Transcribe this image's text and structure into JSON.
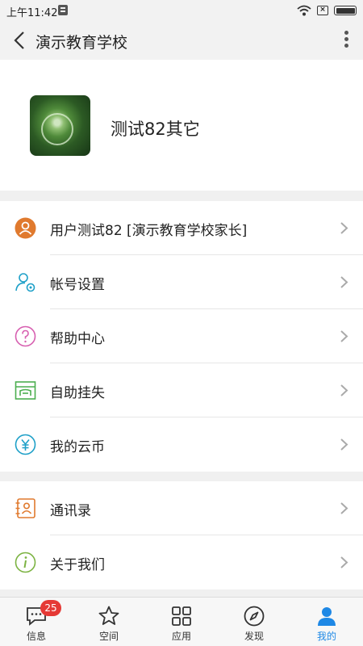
{
  "statusbar": {
    "time": "上午11:42"
  },
  "navbar": {
    "title": "演示教育学校"
  },
  "profile": {
    "name": "测试82其它"
  },
  "menu_group_1": [
    {
      "label": "用户测试82 [演示教育学校家长]",
      "icon": "user-icon",
      "color": "#e07a2e"
    },
    {
      "label": "帐号设置",
      "icon": "account-settings-icon",
      "color": "#1ea0c8"
    },
    {
      "label": "帮助中心",
      "icon": "help-icon",
      "color": "#d75fb0"
    },
    {
      "label": "自助挂失",
      "icon": "report-loss-icon",
      "color": "#4caf50"
    },
    {
      "label": "我的云币",
      "icon": "coin-icon",
      "color": "#1ea0c8"
    }
  ],
  "menu_group_2": [
    {
      "label": "通讯录",
      "icon": "contacts-icon",
      "color": "#e07a2e"
    },
    {
      "label": "关于我们",
      "icon": "info-icon",
      "color": "#7cb342"
    }
  ],
  "tabbar": {
    "tabs": [
      {
        "label": "信息",
        "icon": "message-icon",
        "badge": "25"
      },
      {
        "label": "空间",
        "icon": "star-icon"
      },
      {
        "label": "应用",
        "icon": "apps-grid-icon"
      },
      {
        "label": "发现",
        "icon": "compass-icon"
      },
      {
        "label": "我的",
        "icon": "person-icon",
        "active": true
      }
    ]
  },
  "colors": {
    "accent": "#1e88e5",
    "badge": "#e53935"
  }
}
